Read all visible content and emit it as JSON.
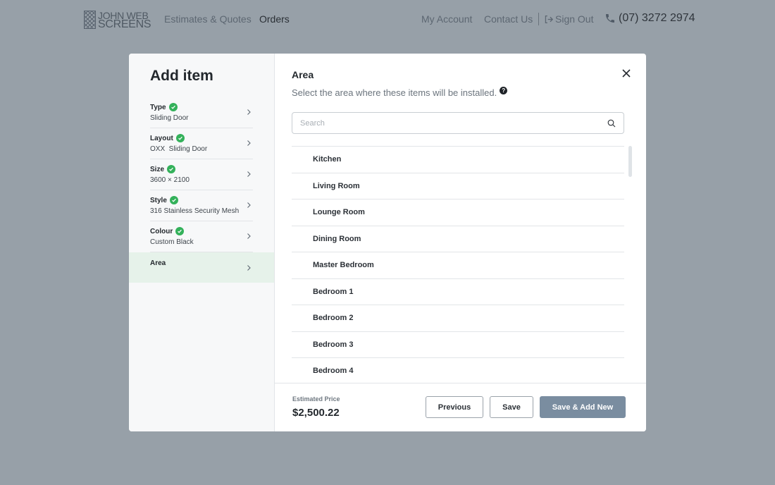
{
  "brand": {
    "line1": "JOHN WEB",
    "line2": "SCREENS"
  },
  "nav": {
    "estimates": "Estimates & Quotes",
    "orders": "Orders",
    "account": "My Account",
    "contact": "Contact Us",
    "signout": "Sign Out",
    "phone": "(07) 3272 2974"
  },
  "modal": {
    "title": "Add item",
    "steps": [
      {
        "label": "Type",
        "value": "Sliding Door",
        "done": true
      },
      {
        "label": "Layout",
        "value": "OXX  Sliding Door",
        "done": true
      },
      {
        "label": "Size",
        "value": "3600 × 2100",
        "done": true
      },
      {
        "label": "Style",
        "value": "316 Stainless Security Mesh",
        "done": true
      },
      {
        "label": "Colour",
        "value": "Custom Black",
        "done": true
      },
      {
        "label": "Area",
        "value": "",
        "done": false
      }
    ],
    "panel": {
      "title": "Area",
      "subtitle": "Select the area where these items will be installed.",
      "help": "?",
      "search_placeholder": "Search",
      "items": [
        "Kitchen",
        "Living Room",
        "Lounge Room",
        "Dining Room",
        "Master Bedroom",
        "Bedroom 1",
        "Bedroom 2",
        "Bedroom 3",
        "Bedroom 4"
      ]
    },
    "footer": {
      "price_label": "Estimated Price",
      "price_value": "$2,500.22",
      "previous": "Previous",
      "save": "Save",
      "save_add": "Save & Add New"
    }
  },
  "colors": {
    "check": "#33b15a",
    "primary_button": "#7a8da0",
    "active_step": "#e6f2ea"
  }
}
